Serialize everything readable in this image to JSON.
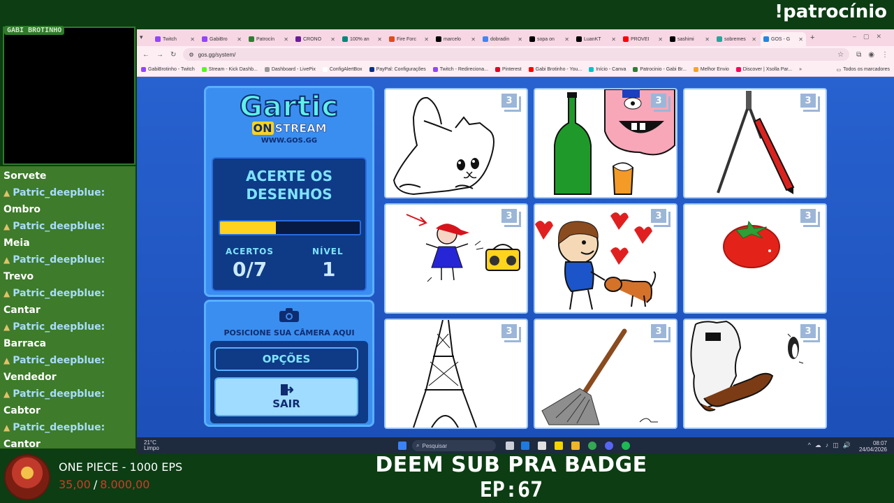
{
  "overlay": {
    "sponsor_command": "!patrocínio",
    "cam_label": "GABI BROTINHO",
    "sub_message": "DEEM SUB PRA BADGE",
    "episode": "EP:67",
    "goal": {
      "title": "ONE PIECE - 1000 EPS",
      "current": "35,00",
      "separator": "/",
      "target": "8.000,00",
      "progress": 0.004375
    }
  },
  "chat": [
    {
      "user": "",
      "message": "Sorvete"
    },
    {
      "user": "Patric_deepblue:",
      "message": "Ombro"
    },
    {
      "user": "Patric_deepblue:",
      "message": "Meia"
    },
    {
      "user": "Patric_deepblue:",
      "message": "Trevo"
    },
    {
      "user": "Patric_deepblue:",
      "message": "Cantar"
    },
    {
      "user": "Patric_deepblue:",
      "message": "Barraca"
    },
    {
      "user": "Patric_deepblue:",
      "message": "Vendedor"
    },
    {
      "user": "Patric_deepblue:",
      "message": "Cabtor"
    },
    {
      "user": "Patric_deepblue:",
      "message": "Cantor"
    }
  ],
  "browser": {
    "tabs": [
      {
        "label": "Twitch",
        "color": "#9146ff"
      },
      {
        "label": "GabiBro",
        "color": "#9146ff"
      },
      {
        "label": "Patrocín",
        "color": "#2e7d32"
      },
      {
        "label": "CRONO",
        "color": "#6a1b9a"
      },
      {
        "label": "100% an",
        "color": "#00897b"
      },
      {
        "label": "Fire Forc",
        "color": "#e64a19"
      },
      {
        "label": "marcelo",
        "color": "#000000"
      },
      {
        "label": "dobradin",
        "color": "#4285f4"
      },
      {
        "label": "sopa on",
        "color": "#000000"
      },
      {
        "label": "LuanKT",
        "color": "#000000"
      },
      {
        "label": "PROVEI",
        "color": "#ff0000"
      },
      {
        "label": "sashimi",
        "color": "#000000"
      },
      {
        "label": "sobremes",
        "color": "#26a69a"
      },
      {
        "label": "GOS - G",
        "color": "#1e88e5"
      }
    ],
    "url": "gos.gg/system/",
    "bookmarks": [
      {
        "label": "GabiBrotinho - Twitch",
        "color": "#9146ff"
      },
      {
        "label": "Stream - Kick Dashb...",
        "color": "#53fc18"
      },
      {
        "label": "Dashboard - LivePix",
        "color": "#999999"
      },
      {
        "label": "ConfigAlertBox",
        "color": "#ffffff"
      },
      {
        "label": "PayPal: Configurações",
        "color": "#003087"
      },
      {
        "label": "Twitch - Redireciona...",
        "color": "#9146ff"
      },
      {
        "label": "Pinterest",
        "color": "#e60023"
      },
      {
        "label": "Gabi Brotinho - You...",
        "color": "#ff0000"
      },
      {
        "label": "Início - Canva",
        "color": "#00c4cc"
      },
      {
        "label": "Patrocinio - Gabi Br...",
        "color": "#2e7d32"
      },
      {
        "label": "Melhor Envio",
        "color": "#f5a623"
      },
      {
        "label": "Discover | Xsolla Par...",
        "color": "#ff005b"
      }
    ],
    "bookmarks_all": "Todos os marcadores"
  },
  "game": {
    "logo_title": "Gartic",
    "logo_on": "ON",
    "logo_stream": "STREAM",
    "logo_url": "WWW.GOS.GG",
    "task_line1": "ACERTE OS",
    "task_line2": "DESENHOS",
    "progress": 0.4,
    "hits_label": "ACERTOS",
    "hits_value": "0/7",
    "level_label": "NÍVEL",
    "level_value": "1",
    "camera_text": "POSICIONE SUA CÂMERA AQUI",
    "options_label": "OPÇÕES",
    "exit_label": "SAIR",
    "drawings": [
      {
        "subject": "cat",
        "count": "3"
      },
      {
        "subject": "bottle-face-beer",
        "count": "3"
      },
      {
        "subject": "compass-pencil",
        "count": "3"
      },
      {
        "subject": "girl-radio",
        "count": "3"
      },
      {
        "subject": "man-dog-hearts",
        "count": "3"
      },
      {
        "subject": "tomato",
        "count": "3"
      },
      {
        "subject": "eiffel-tower",
        "count": "3"
      },
      {
        "subject": "broom",
        "count": "3"
      },
      {
        "subject": "yeti-penguin",
        "count": "3"
      }
    ]
  },
  "taskbar": {
    "temperature": "21°C",
    "weather": "Limpo",
    "search_placeholder": "Pesquisar",
    "time": "08:07",
    "date": "24/04/2026"
  }
}
